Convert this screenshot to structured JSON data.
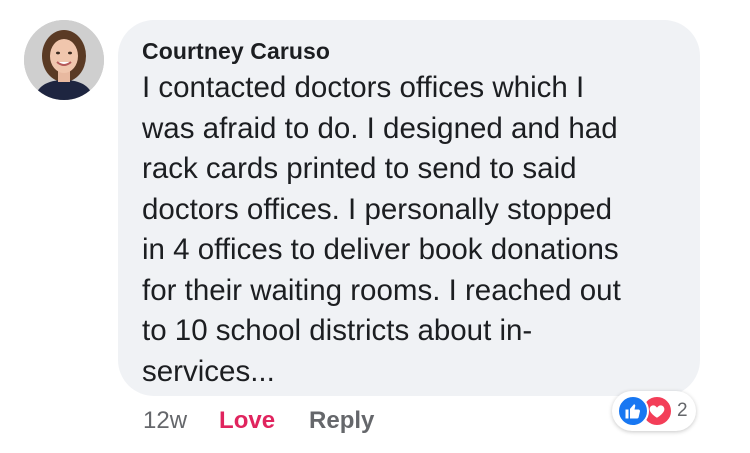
{
  "comment": {
    "author": "Courtney Caruso",
    "text": "I contacted doctors offices which I\nwas afraid to do. I designed and had\nrack cards printed to send to said\ndoctors offices. I personally stopped\nin 4 offices to deliver book donations\nfor their waiting rooms. I reached out\nto 10 school districts about in-\nservices...",
    "time": "12w",
    "love_label": "Love",
    "reply_label": "Reply",
    "reaction_count": "2"
  },
  "icons": {
    "avatar": "profile-photo",
    "reaction_1": "like-icon",
    "reaction_2": "love-icon"
  },
  "colors": {
    "bubble": "#f0f2f5",
    "love_active": "#e0245e",
    "like_blue": "#1877f2",
    "love_red": "#f33e58",
    "meta_gray": "#65676b"
  }
}
